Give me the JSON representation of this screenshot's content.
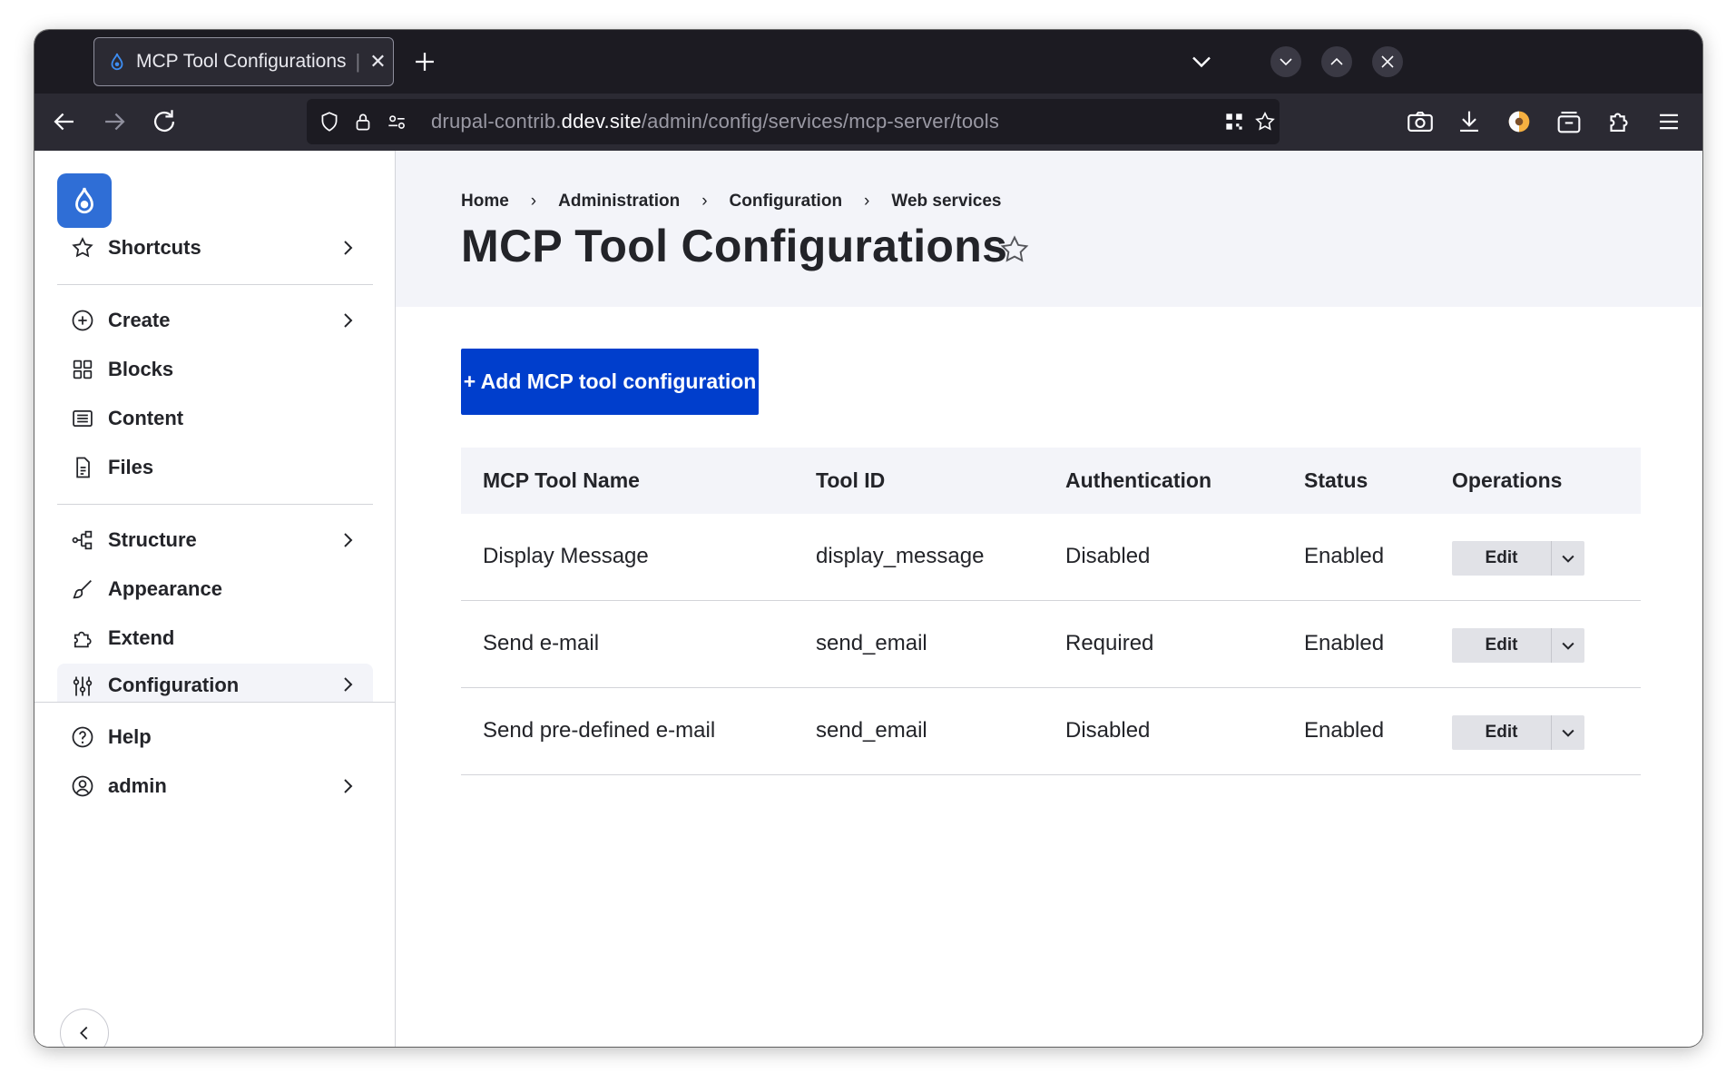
{
  "browser": {
    "tab_title": "MCP Tool Configurations",
    "url_prefix": "drupal-contrib.",
    "url_domain": "ddev.site",
    "url_path": "/admin/config/services/mcp-server/tools"
  },
  "sidebar": {
    "items": [
      {
        "label": "Shortcuts",
        "icon": "star-icon",
        "has_children": true
      },
      {
        "label": "Create",
        "icon": "plus-circle-icon",
        "has_children": true
      },
      {
        "label": "Blocks",
        "icon": "blocks-grid-icon",
        "has_children": false
      },
      {
        "label": "Content",
        "icon": "content-icon",
        "has_children": false
      },
      {
        "label": "Files",
        "icon": "file-icon",
        "has_children": false
      },
      {
        "label": "Structure",
        "icon": "structure-icon",
        "has_children": true
      },
      {
        "label": "Appearance",
        "icon": "brush-icon",
        "has_children": false
      },
      {
        "label": "Extend",
        "icon": "puzzle-icon",
        "has_children": false
      },
      {
        "label": "Configuration",
        "icon": "sliders-icon",
        "has_children": true,
        "active": true
      },
      {
        "label": "Help",
        "icon": "help-icon",
        "has_children": false
      },
      {
        "label": "admin",
        "icon": "user-icon",
        "has_children": true
      }
    ]
  },
  "breadcrumb": [
    "Home",
    "Administration",
    "Configuration",
    "Web services"
  ],
  "page": {
    "title": "MCP Tool Configurations",
    "add_button": "+ Add MCP tool configuration"
  },
  "table": {
    "columns": [
      "MCP Tool Name",
      "Tool ID",
      "Authentication",
      "Status",
      "Operations"
    ],
    "rows": [
      {
        "name": "Display Message",
        "tool_id": "display_message",
        "auth": "Disabled",
        "status": "Enabled",
        "op": "Edit"
      },
      {
        "name": "Send e-mail",
        "tool_id": "send_email",
        "auth": "Required",
        "status": "Enabled",
        "op": "Edit"
      },
      {
        "name": "Send pre-defined e-mail",
        "tool_id": "send_email",
        "auth": "Disabled",
        "status": "Enabled",
        "op": "Edit"
      }
    ]
  },
  "colors": {
    "primary": "#003ecc",
    "logo": "#2f6ed6",
    "text": "#232429",
    "header_bg": "#f3f4f9"
  }
}
